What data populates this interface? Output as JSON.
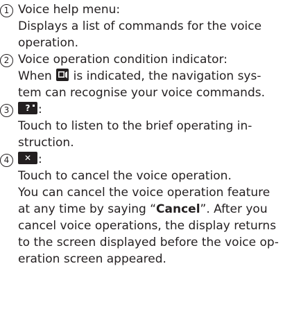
{
  "items": [
    {
      "number": "1",
      "heading": "Voice help menu:",
      "lines": [
        "Displays a list of commands for the voice",
        "operation."
      ]
    },
    {
      "number": "2",
      "heading": "Voice operation condition indicator:",
      "line1_pre": "When ",
      "line1_post": " is indicated, the navigation sys-",
      "line2": "tem can recognise your voice commands.",
      "icon": "voice-indicator-icon"
    },
    {
      "number": "3",
      "heading_suffix": ":",
      "key_label": "?",
      "icon": "help-question-icon",
      "lines": [
        "Touch to listen to the brief operating in-",
        "struction."
      ]
    },
    {
      "number": "4",
      "heading_suffix": ":",
      "key_label": "✕",
      "icon": "cancel-x-icon",
      "lines": [
        "Touch to cancel the voice operation.",
        "You can cancel the voice operation feature"
      ],
      "line3_pre": "at any time by saying “",
      "line3_bold": "Cancel",
      "line3_post": "”. After you",
      "lines_tail": [
        "cancel voice operations, the display returns",
        "to the screen displayed before the voice op-",
        "eration screen appeared."
      ]
    }
  ]
}
